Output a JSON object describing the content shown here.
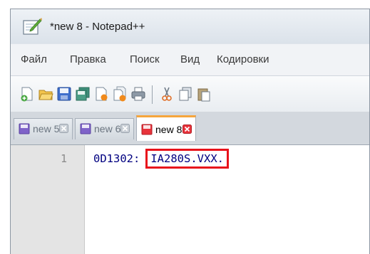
{
  "window": {
    "title": "*new 8 - Notepad++"
  },
  "menu": {
    "items": [
      "Файл",
      "Правка",
      "Поиск",
      "Вид",
      "Кодировки"
    ]
  },
  "toolbar": {
    "buttons": [
      "new-file-icon",
      "open-file-icon",
      "save-icon",
      "save-all-icon",
      "close-file-icon",
      "close-all-icon",
      "print-icon",
      "cut-icon",
      "copy-icon",
      "paste-icon"
    ]
  },
  "tabs": [
    {
      "label": "new 5",
      "active": false
    },
    {
      "label": "new 6",
      "active": false
    },
    {
      "label": "new 8",
      "active": true
    }
  ],
  "editor": {
    "line_number": "1",
    "code_prefix": "0D1302:",
    "code_highlighted": "IA280S.VXX."
  },
  "colors": {
    "highlight_border": "#e8121b",
    "active_tab_accent": "#f6a53c",
    "code_text": "#000080"
  }
}
